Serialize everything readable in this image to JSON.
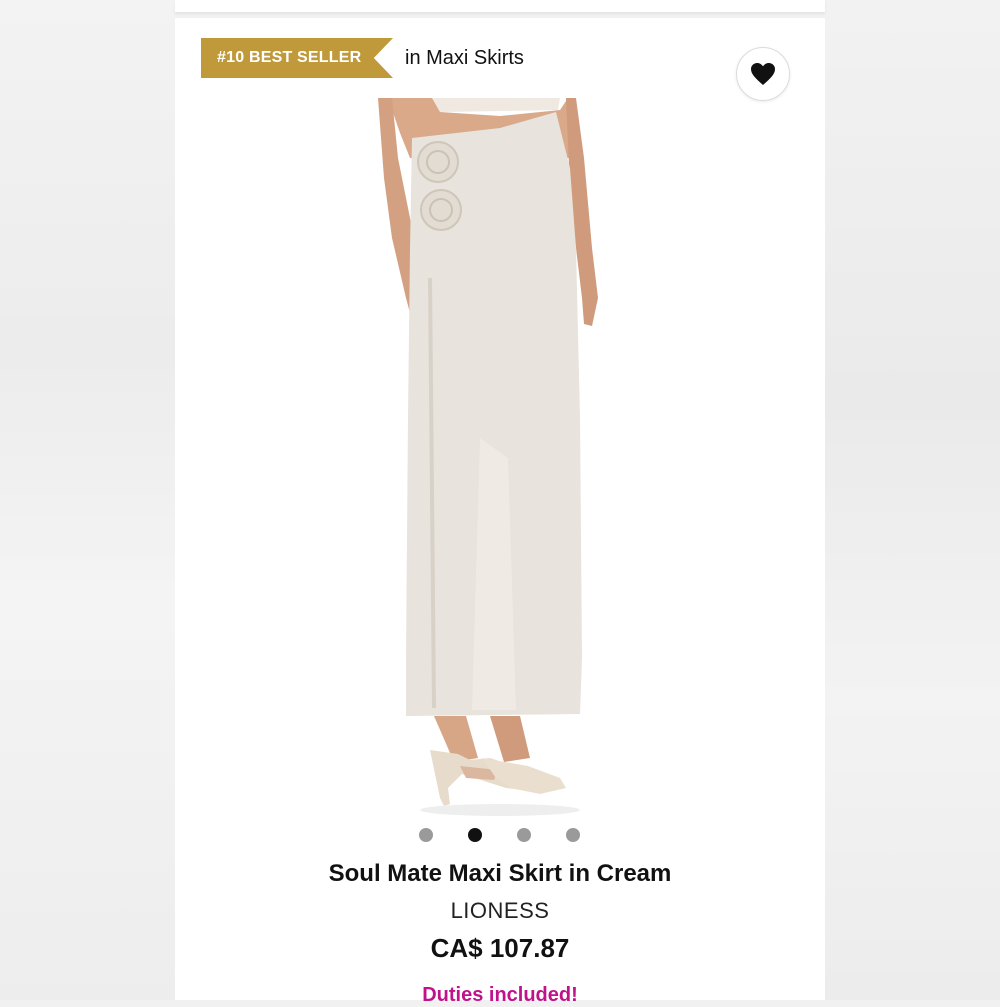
{
  "badge": {
    "rank_label": "#10 BEST SELLER",
    "category": "in Maxi Skirts"
  },
  "wishlist": {
    "icon": "heart-icon"
  },
  "product": {
    "name": "Soul Mate Maxi Skirt in Cream",
    "brand": "LIONESS",
    "price": "CA$ 107.87",
    "duties_note": "Duties included!"
  },
  "carousel": {
    "count": 4,
    "active_index": 1
  },
  "colors": {
    "badge_gold": "#c09a3a",
    "duties_magenta": "#c0128a",
    "skirt_cream": "#e8e3dc",
    "dot_inactive": "#9a9a9a",
    "dot_active": "#111111"
  }
}
